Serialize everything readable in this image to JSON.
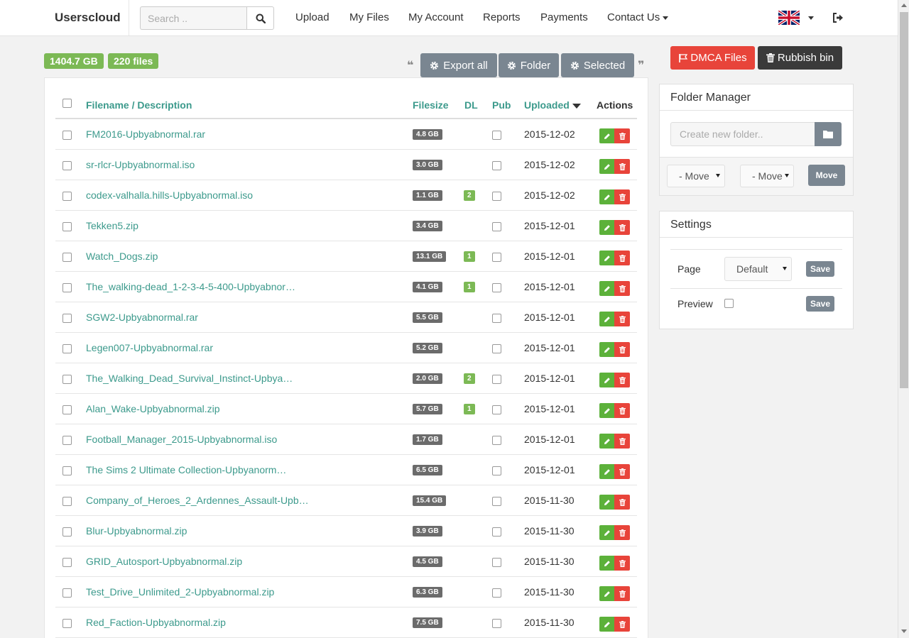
{
  "navbar": {
    "brand": "Userscloud",
    "search_placeholder": "Search ..",
    "items": [
      "Upload",
      "My Files",
      "My Account",
      "Reports",
      "Payments",
      "Contact Us"
    ]
  },
  "stats": {
    "total_size": "1404.7 GB",
    "file_count": "220 files"
  },
  "toolbar": {
    "export_all": "Export all",
    "folder": "Folder",
    "selected": "Selected"
  },
  "table": {
    "headers": {
      "filename": "Filename / Description",
      "filesize": "Filesize",
      "dl": "DL",
      "pub": "Pub",
      "uploaded": "Uploaded",
      "actions": "Actions"
    },
    "rows": [
      {
        "name": "FM2016-Upbyabnormal.rar",
        "size": "4.8 GB",
        "dl": "",
        "date": "2015-12-02"
      },
      {
        "name": "sr-rlcr-Upbyabnormal.iso",
        "size": "3.0 GB",
        "dl": "",
        "date": "2015-12-02"
      },
      {
        "name": "codex-valhalla.hills-Upbyabnormal.iso",
        "size": "1.1 GB",
        "dl": "2",
        "date": "2015-12-02"
      },
      {
        "name": "Tekken5.zip",
        "size": "3.4 GB",
        "dl": "",
        "date": "2015-12-01"
      },
      {
        "name": "Watch_Dogs.zip",
        "size": "13.1 GB",
        "dl": "1",
        "date": "2015-12-01"
      },
      {
        "name": "The_walking-dead_1-2-3-4-5-400-Upbyabnor…",
        "size": "4.1 GB",
        "dl": "1",
        "date": "2015-12-01"
      },
      {
        "name": "SGW2-Upbyabnormal.rar",
        "size": "5.5 GB",
        "dl": "",
        "date": "2015-12-01"
      },
      {
        "name": "Legen007-Upbyabnormal.rar",
        "size": "5.2 GB",
        "dl": "",
        "date": "2015-12-01"
      },
      {
        "name": "The_Walking_Dead_Survival_Instinct-Upbya…",
        "size": "2.0 GB",
        "dl": "2",
        "date": "2015-12-01"
      },
      {
        "name": "Alan_Wake-Upbyabnormal.zip",
        "size": "5.7 GB",
        "dl": "1",
        "date": "2015-12-01"
      },
      {
        "name": "Football_Manager_2015-Upbyabnormal.iso",
        "size": "1.7 GB",
        "dl": "",
        "date": "2015-12-01"
      },
      {
        "name": "The Sims 2 Ultimate Collection-Upbyanorm…",
        "size": "6.5 GB",
        "dl": "",
        "date": "2015-12-01"
      },
      {
        "name": "Company_of_Heroes_2_Ardennes_Assault-Upb…",
        "size": "15.4 GB",
        "dl": "",
        "date": "2015-11-30"
      },
      {
        "name": "Blur-Upbyabnormal.zip",
        "size": "3.9 GB",
        "dl": "",
        "date": "2015-11-30"
      },
      {
        "name": "GRID_Autosport-Upbyabnormal.zip",
        "size": "4.5 GB",
        "dl": "",
        "date": "2015-11-30"
      },
      {
        "name": "Test_Drive_Unlimited_2-Upbyabnormal.zip",
        "size": "6.3 GB",
        "dl": "",
        "date": "2015-11-30"
      },
      {
        "name": "Red_Faction-Upbyabnormal.zip",
        "size": "7.5 GB",
        "dl": "",
        "date": "2015-11-30"
      }
    ]
  },
  "side": {
    "dmca": "DMCA Files",
    "rubbish": "Rubbish bin",
    "folder_manager": {
      "title": "Folder Manager",
      "placeholder": "Create new folder..",
      "select1": "- Move",
      "select2": "- Move",
      "move_label": "Move"
    },
    "settings": {
      "title": "Settings",
      "page_label": "Page",
      "page_value": "Default",
      "preview_label": "Preview",
      "save_label": "Save"
    }
  },
  "colors": {
    "accent": "#3c9a8c",
    "green": "#7cb955",
    "red": "#e8443a",
    "gray_btn": "#7a8691"
  }
}
